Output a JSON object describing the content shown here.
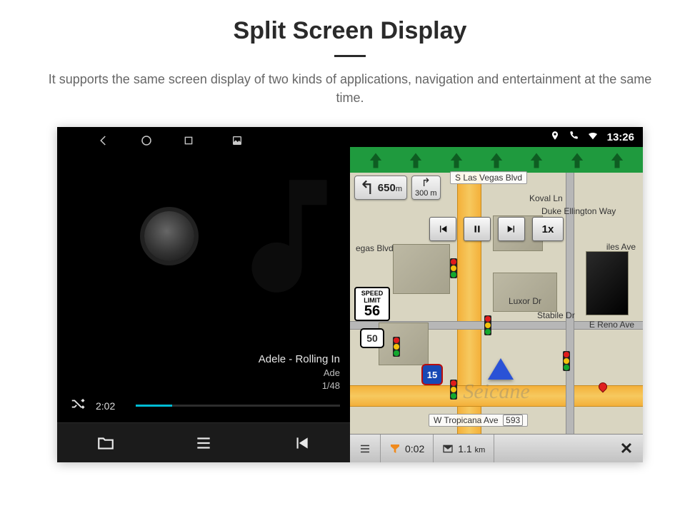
{
  "header": {
    "title": "Split Screen Display",
    "description": "It supports the same screen display of two kinds of applications, navigation and entertainment at the same time."
  },
  "status": {
    "clock": "13:26"
  },
  "music": {
    "track_line1": "Adele - Rolling In",
    "track_line2": "Ade",
    "counter": "1/48",
    "elapsed": "2:02"
  },
  "nav": {
    "streets": {
      "top": "S Las Vegas Blvd",
      "right_1": "Koval Ln",
      "right_2": "Duke Ellington Way",
      "mid_right": "iles Ave",
      "left_cut": "egas Blvd",
      "luxor": "Luxor Dr",
      "stabile": "Stabile Dr",
      "reno": "E Reno Ave",
      "bottom": "W Tropicana Ave",
      "bottom_num": "593"
    },
    "turn": {
      "primary_dist": "650",
      "primary_unit": "m",
      "secondary_dist": "300",
      "secondary_unit": "m"
    },
    "speed_control": "1x",
    "speed_limit_label": "SPEED LIMIT",
    "speed_limit_value": "56",
    "route_shield": "50",
    "interstate": "15",
    "bottom_bar": {
      "elapsed": "0:02",
      "distance": "1.1",
      "distance_unit": "km"
    }
  },
  "watermark": "Seicane"
}
